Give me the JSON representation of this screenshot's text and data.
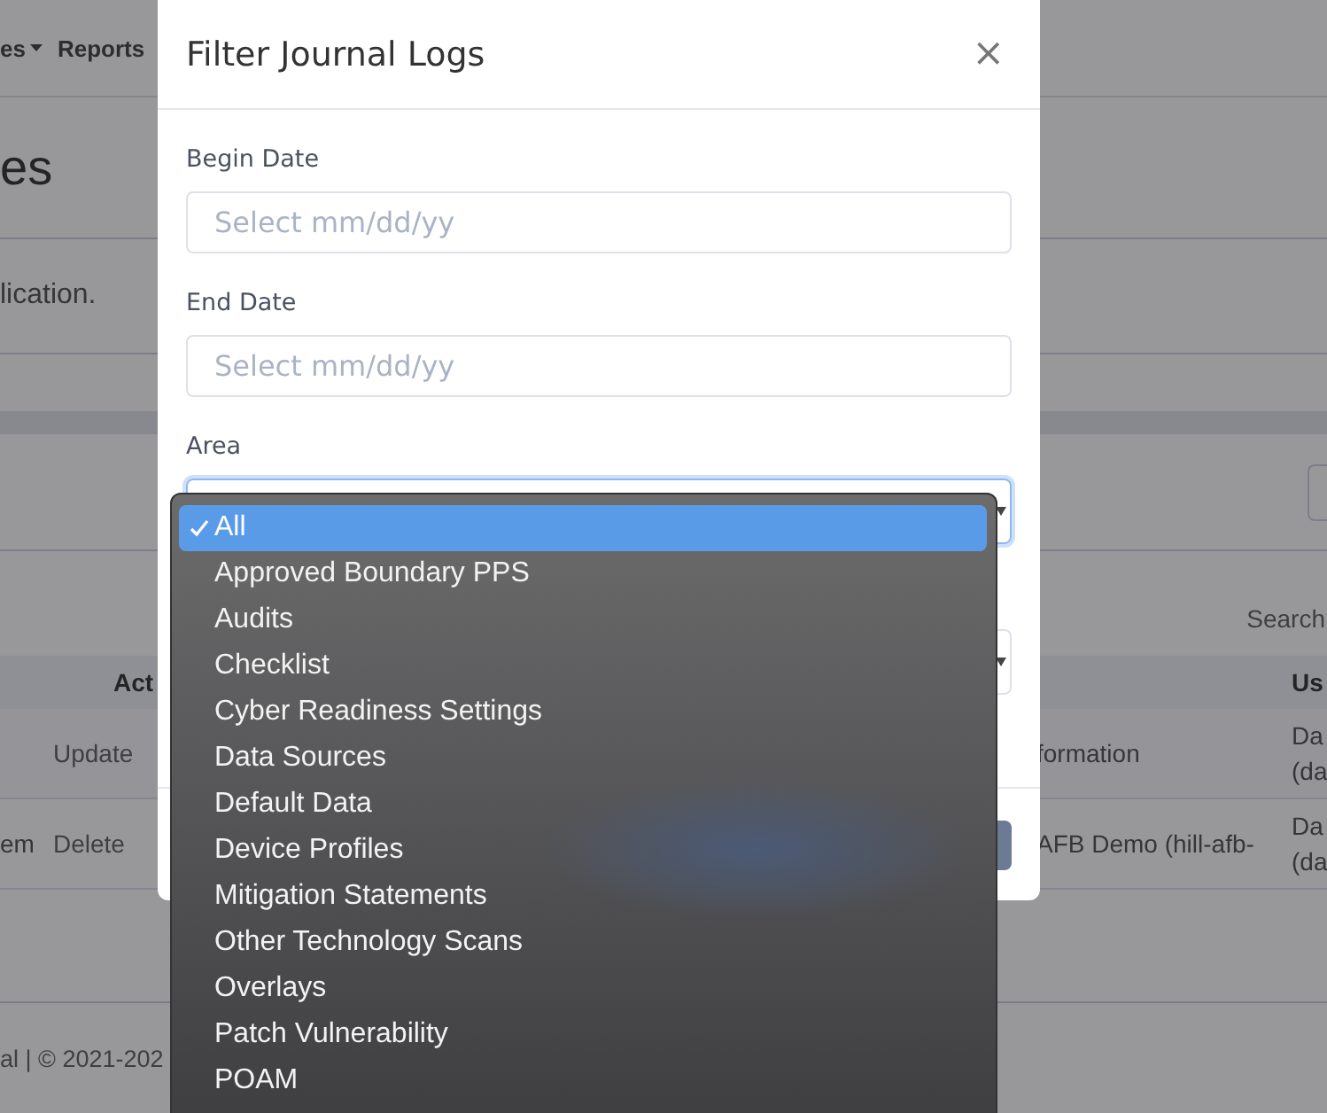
{
  "background_page": {
    "nav_items": [
      {
        "label": "es",
        "dropdown": true
      },
      {
        "label": "Reports",
        "dropdown": false
      }
    ],
    "heading": "es",
    "description": "lication.",
    "search_label": "Search",
    "table": {
      "columns": [
        "Act",
        "Us"
      ],
      "rows": [
        {
          "column_1": "",
          "action": "Update",
          "column_3": "formation",
          "column_4": [
            "Da",
            "(da"
          ]
        },
        {
          "column_1": "em",
          "action": "Delete",
          "column_3": "AFB Demo (hill-afb-",
          "column_4": [
            "Da",
            "(da"
          ]
        }
      ]
    },
    "footer": "al | © 2021-202"
  },
  "modal": {
    "title": "Filter Journal Logs",
    "close": "×",
    "fields": [
      {
        "label": "Begin Date",
        "placeholder": "Select mm/dd/yy"
      },
      {
        "label": "End Date",
        "placeholder": "Select mm/dd/yy"
      }
    ],
    "area": {
      "label": "Area",
      "options": [
        {
          "label": "All",
          "selected": true
        },
        {
          "label": "Approved Boundary PPS",
          "selected": false
        },
        {
          "label": "Audits",
          "selected": false
        },
        {
          "label": "Checklist",
          "selected": false
        },
        {
          "label": "Cyber Readiness Settings",
          "selected": false
        },
        {
          "label": "Data Sources",
          "selected": false
        },
        {
          "label": "Default Data",
          "selected": false
        },
        {
          "label": "Device Profiles",
          "selected": false
        },
        {
          "label": "Mitigation Statements",
          "selected": false
        },
        {
          "label": "Other Technology Scans",
          "selected": false
        },
        {
          "label": "Overlays",
          "selected": false
        },
        {
          "label": "Patch Vulnerability",
          "selected": false
        },
        {
          "label": "POAM",
          "selected": false
        }
      ]
    }
  }
}
